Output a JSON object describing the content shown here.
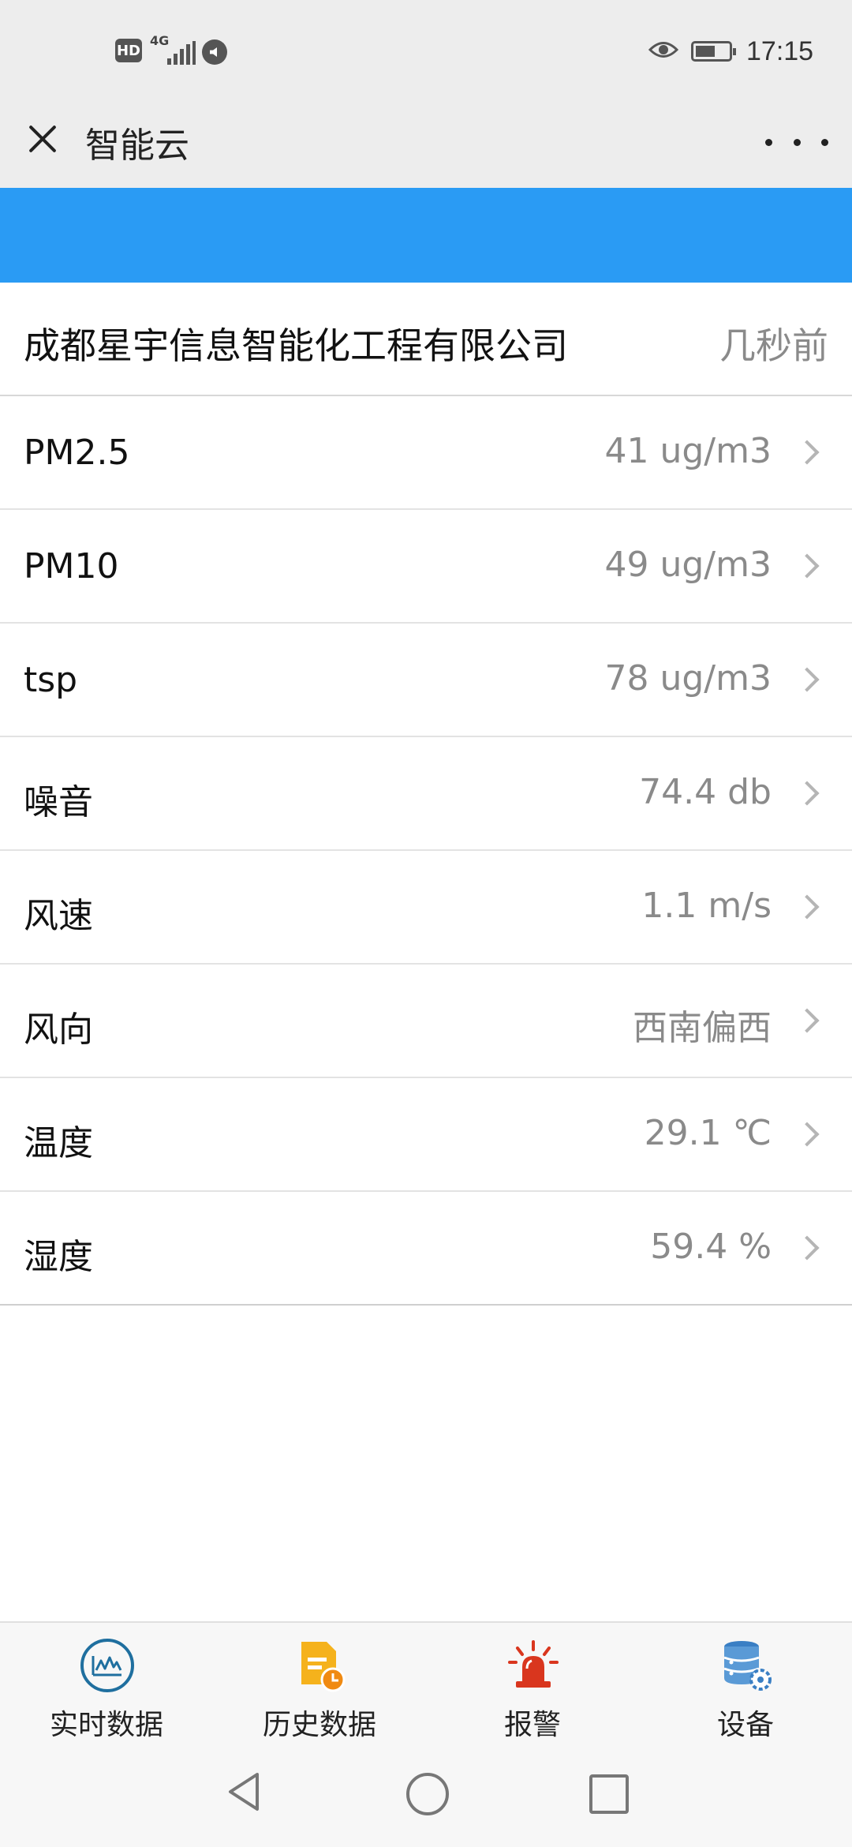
{
  "status_bar": {
    "hd": "HD",
    "network": "4G",
    "time": "17:15"
  },
  "header": {
    "title": "智能云"
  },
  "company": {
    "name": "成都星宇信息智能化工程有限公司",
    "updated": "几秒前"
  },
  "readings": [
    {
      "label": "PM2.5",
      "value": "41 ug/m3"
    },
    {
      "label": "PM10",
      "value": "49 ug/m3"
    },
    {
      "label": "tsp",
      "value": "78 ug/m3"
    },
    {
      "label": "噪音",
      "value": "74.4 db"
    },
    {
      "label": "风速",
      "value": "1.1 m/s"
    },
    {
      "label": "风向",
      "value": "西南偏西"
    },
    {
      "label": "温度",
      "value": "29.1 ℃"
    },
    {
      "label": "湿度",
      "value": "59.4 %"
    }
  ],
  "tabs": [
    {
      "label": "实时数据",
      "icon": "realtime-chart-icon"
    },
    {
      "label": "历史数据",
      "icon": "history-document-icon"
    },
    {
      "label": "报警",
      "icon": "alarm-siren-icon"
    },
    {
      "label": "设备",
      "icon": "device-database-gear-icon"
    }
  ],
  "colors": {
    "blue_banner": "#2a9bf4",
    "alarm_red": "#d9361e",
    "history_orange": "#f5a81c",
    "realtime_blue": "#1f6f9f",
    "device_blue": "#3a7fc4"
  }
}
